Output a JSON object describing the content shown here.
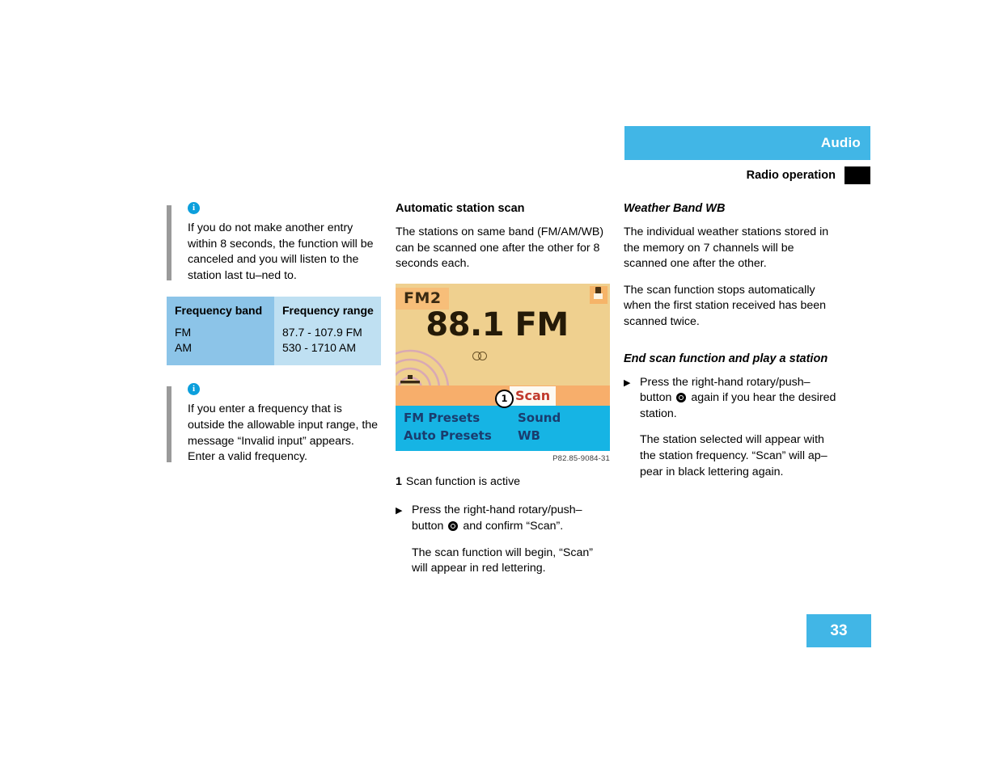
{
  "header": {
    "section_title": "Audio",
    "page_subtitle": "Radio operation"
  },
  "left_column": {
    "info_box_1": {
      "icon": "info-icon",
      "text": "If you do not make another entry within 8 seconds, the function will be canceled and you will listen to the station last tu–ned to."
    },
    "frequency_table": {
      "headers": [
        "Frequency band",
        "Frequency range"
      ],
      "rows": [
        {
          "band": "FM",
          "range": "87.7 - 107.9 FM"
        },
        {
          "band": "AM",
          "range": "530 - 1710 AM"
        }
      ]
    },
    "info_box_2": {
      "icon": "info-icon",
      "text": "If you enter a frequency that is outside the allowable input range, the message “Invalid input” appears. Enter a valid frequency."
    }
  },
  "middle_column": {
    "heading": "Automatic station scan",
    "paragraph": "The stations on same band (FM/AM/WB) can be scanned one after the other for 8 seconds each.",
    "radio_display": {
      "band_label": "FM2",
      "frequency": "88.1 FM",
      "stereo_indicator": "stereo-icon",
      "scan_label": "Scan",
      "callout_number": "1",
      "menu_items": [
        "FM Presets",
        "Auto Presets",
        "Sound",
        "WB"
      ],
      "tower_icon": "radio-tower-icon",
      "corner_icon": "traffic-info-icon"
    },
    "figure_code": "P82.85-9084-31",
    "legend": {
      "number": "1",
      "text": "Scan function is active"
    },
    "step": {
      "text_before_icon": "Press the right-hand rotary/push–button",
      "icon": "rotary-push-button-icon",
      "text_after_icon": "and confirm “Scan”.",
      "sub_text": "The scan function will begin, “Scan” will appear in red lettering."
    }
  },
  "right_column": {
    "heading_1": "Weather Band WB",
    "paragraph_1": "The individual weather stations stored in the memory on 7 channels will be scanned one after the other.",
    "paragraph_2": "The scan function stops automatically when the first station received has been scanned twice.",
    "heading_2": "End scan function and play a station",
    "step": {
      "text_before_icon": "Press the right-hand rotary/push–button",
      "icon": "rotary-push-button-icon",
      "text_after_icon": "again if you hear the desired station.",
      "sub_text": "The station selected will appear with the station frequency. “Scan” will ap–pear in black lettering again."
    }
  },
  "footer": {
    "page_number": "33"
  },
  "colors": {
    "accent_blue": "#41b6e6",
    "table_band": "#8cc4e8",
    "table_range": "#bfe0f2",
    "info_rule": "#9a9a9a",
    "display_bg": "#efd08f",
    "display_bottom": "#16b4e4",
    "scan_red": "#c0392b"
  }
}
